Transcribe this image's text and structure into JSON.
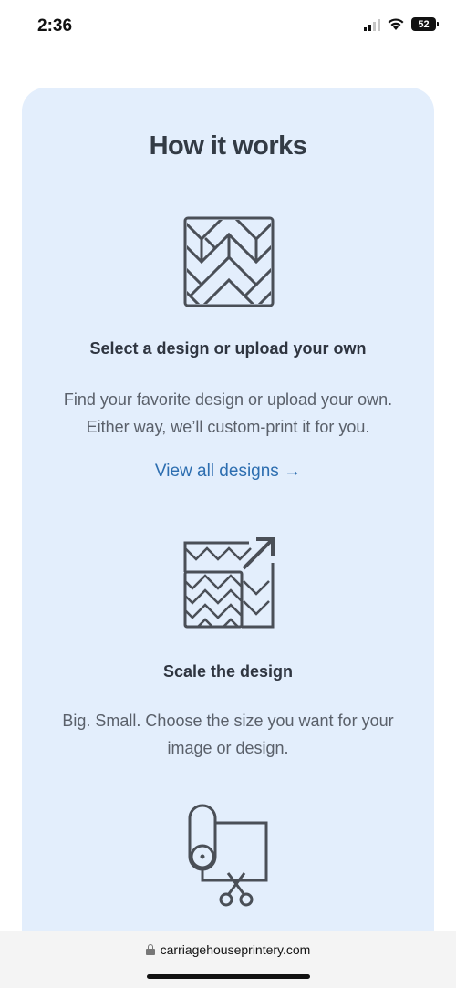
{
  "status": {
    "time": "2:36",
    "battery": "52"
  },
  "how_it_works": {
    "title": "How it works",
    "steps": [
      {
        "icon": "herringbone-pattern-icon",
        "title": "Select a design or upload your own",
        "desc_line1": "Find your favorite design or upload your own.",
        "desc_line2": "Either way, we’ll custom-print it for you.",
        "link": "View all designs →"
      },
      {
        "icon": "scale-pattern-icon",
        "title": "Scale the design",
        "desc_line1": "Big. Small. Choose the size you want for your",
        "desc_line2": "image or design."
      },
      {
        "icon": "wallpaper-roll-scissors-icon"
      }
    ]
  },
  "browser": {
    "url": "carriagehouseprintery.com"
  }
}
